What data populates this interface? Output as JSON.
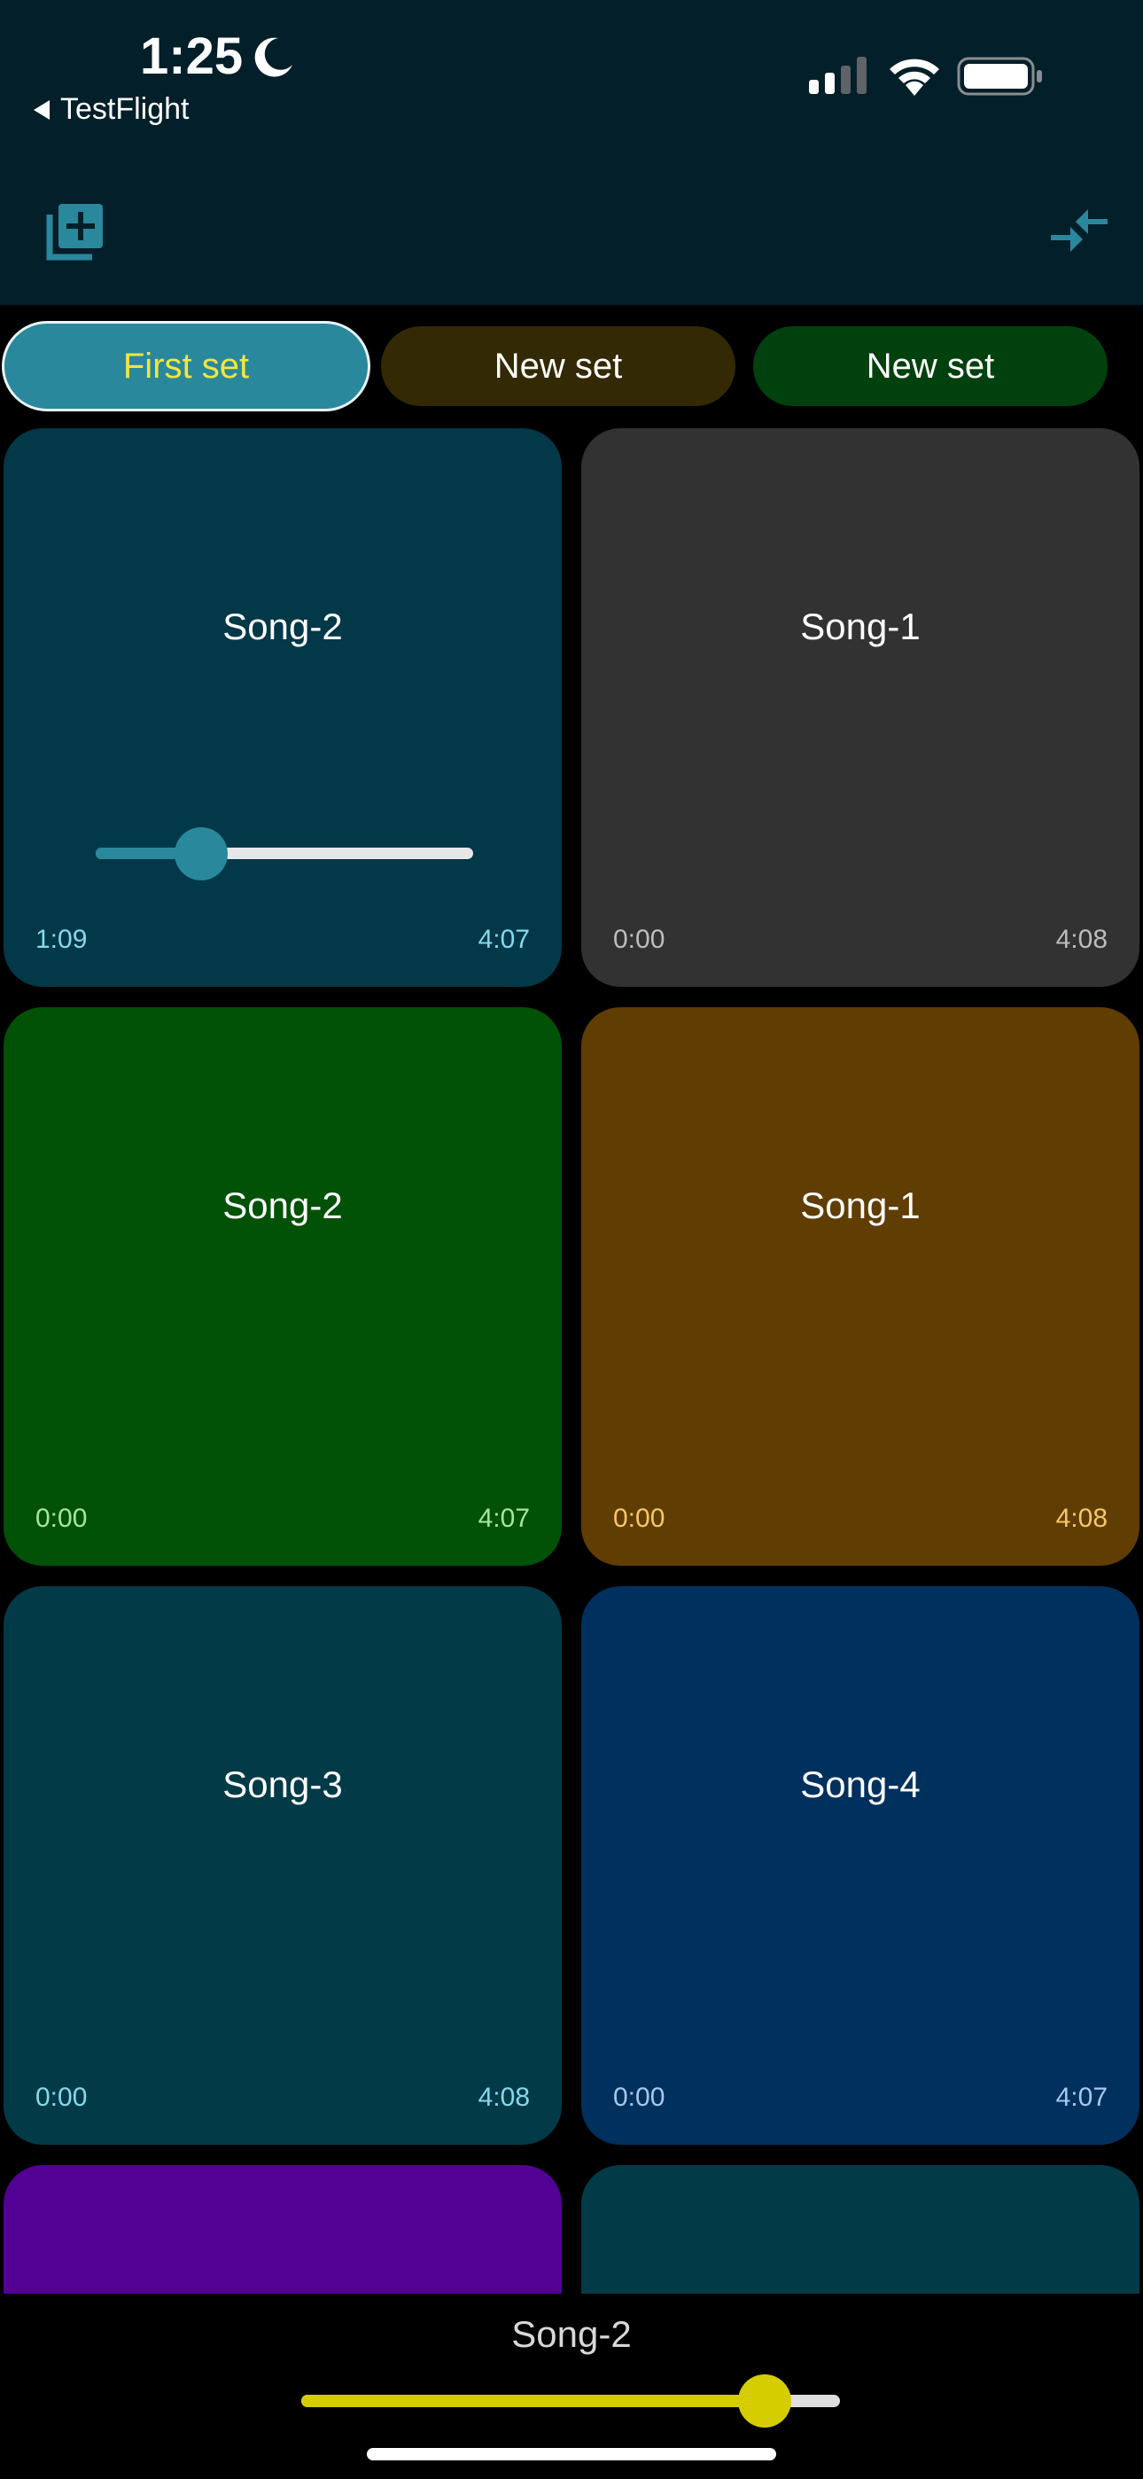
{
  "status_bar": {
    "time": "1:25",
    "back_app": "TestFlight",
    "icons": [
      "moon-icon",
      "signal-icon",
      "wifi-icon",
      "battery-icon"
    ]
  },
  "toolbar": {
    "left_icon": "add-set-icon",
    "right_icon": "collapse-icon",
    "accent": "#2a889d"
  },
  "tabs": [
    {
      "label": "First set",
      "selected": true,
      "color": "#2a889d"
    },
    {
      "label": "New set",
      "selected": false,
      "color": "#332a05"
    },
    {
      "label": "New set",
      "selected": false,
      "color": "#01410e"
    }
  ],
  "songs": [
    {
      "title": "Song-2",
      "start": "1:09",
      "end": "4:07",
      "color": "#023847",
      "progress": 0.28
    },
    {
      "title": "Song-1",
      "start": "0:00",
      "end": "4:08",
      "color": "#323232"
    },
    {
      "title": "Song-2",
      "start": "0:00",
      "end": "4:07",
      "color": "#015107"
    },
    {
      "title": "Song-1",
      "start": "0:00",
      "end": "4:08",
      "color": "#603d02"
    },
    {
      "title": "Song-3",
      "start": "0:00",
      "end": "4:08",
      "color": "#023a47"
    },
    {
      "title": "Song-4",
      "start": "0:00",
      "end": "4:07",
      "color": "#00305d"
    },
    {
      "color": "#530095"
    },
    {
      "color": "#023a47"
    }
  ],
  "player": {
    "now_playing": "Song-2",
    "volume": 0.86,
    "accent": "#d6cd00"
  }
}
